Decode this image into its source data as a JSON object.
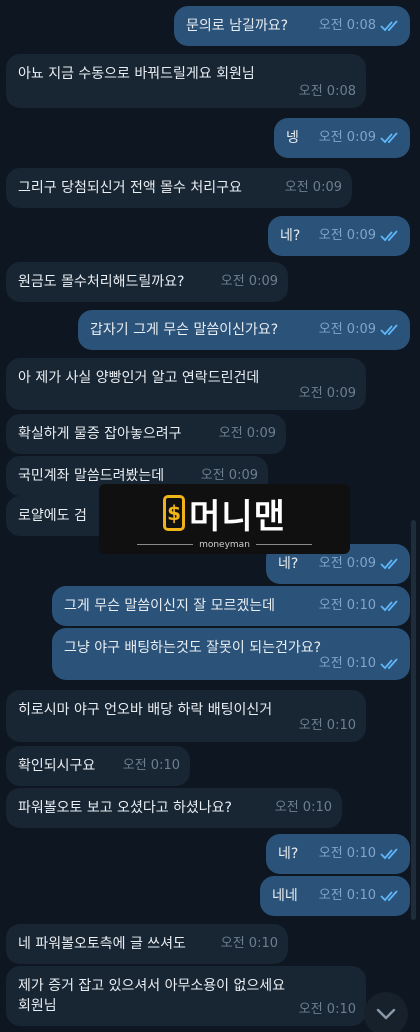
{
  "messages": [
    {
      "dir": "out",
      "text": "문의로 남길까요?",
      "time": "오전 0:08",
      "read": true
    },
    {
      "dir": "in",
      "text": "아뇨 지금 수동으로 바꿔드릴게요 회원님",
      "time": "오전 0:08"
    },
    {
      "dir": "out",
      "text": "넹",
      "time": "오전 0:09",
      "read": true
    },
    {
      "dir": "in",
      "text": "그리구 당첨되신거 전액 몰수 처리구요",
      "time": "오전 0:09"
    },
    {
      "dir": "out",
      "text": "네?",
      "time": "오전 0:09",
      "read": true
    },
    {
      "dir": "in",
      "text": "원금도 몰수처리해드릴까요?",
      "time": "오전 0:09"
    },
    {
      "dir": "out",
      "text": "갑자기 그게 무슨 말씀이신가요?",
      "time": "오전 0:09",
      "read": true
    },
    {
      "dir": "in",
      "text": "아 제가 사실 양빵인거 알고 연락드린건데",
      "time": "오전 0:09"
    },
    {
      "dir": "in",
      "text": "확실하게 물증 잡아놓으려구",
      "time": "오전 0:09"
    },
    {
      "dir": "in",
      "text": "국민계좌 말씀드려봤는데",
      "time": "오전 0:09"
    },
    {
      "dir": "in",
      "text": "로얄에도 검",
      "time": ""
    },
    {
      "dir": "out",
      "text": "네?",
      "time": "오전 0:09",
      "read": true
    },
    {
      "dir": "out",
      "text": "그게 무슨 말씀이신지 잘 모르겠는데",
      "time": "오전 0:10",
      "read": true
    },
    {
      "dir": "out",
      "text": "그냥 야구 배팅하는것도 잘못이 되는건가요?",
      "time": "오전 0:10",
      "read": true
    },
    {
      "dir": "in",
      "text": "히로시마 야구 언오바 배당 하락 배팅이신거",
      "time": "오전 0:10"
    },
    {
      "dir": "in",
      "text": "확인되시구요",
      "time": "오전 0:10"
    },
    {
      "dir": "in",
      "text": "파워볼오토 보고 오셨다고 하셨나요?",
      "time": "오전 0:10"
    },
    {
      "dir": "out",
      "text": "네?",
      "time": "오전 0:10",
      "read": true
    },
    {
      "dir": "out",
      "text": "네네",
      "time": "오전 0:10",
      "read": true
    },
    {
      "dir": "in",
      "text": "네 파워볼오토측에 글 쓰셔도",
      "time": "오전 0:10"
    },
    {
      "dir": "in",
      "text": "제가 증거 잡고 있으셔서 아무소용이 없으세요\n회원님",
      "time": "오전 0:10"
    }
  ],
  "watermark": {
    "logo_glyph": "$",
    "title": "머니맨",
    "subtitle": "moneyman"
  },
  "icons": {
    "read": "double-check-icon",
    "scroll_down": "chevron-down-icon"
  },
  "colors": {
    "background": "#0e1621",
    "incoming_bubble": "#182533",
    "outgoing_bubble": "#2b5278",
    "check": "#5eb5f7",
    "watermark_accent": "#f0b418"
  }
}
